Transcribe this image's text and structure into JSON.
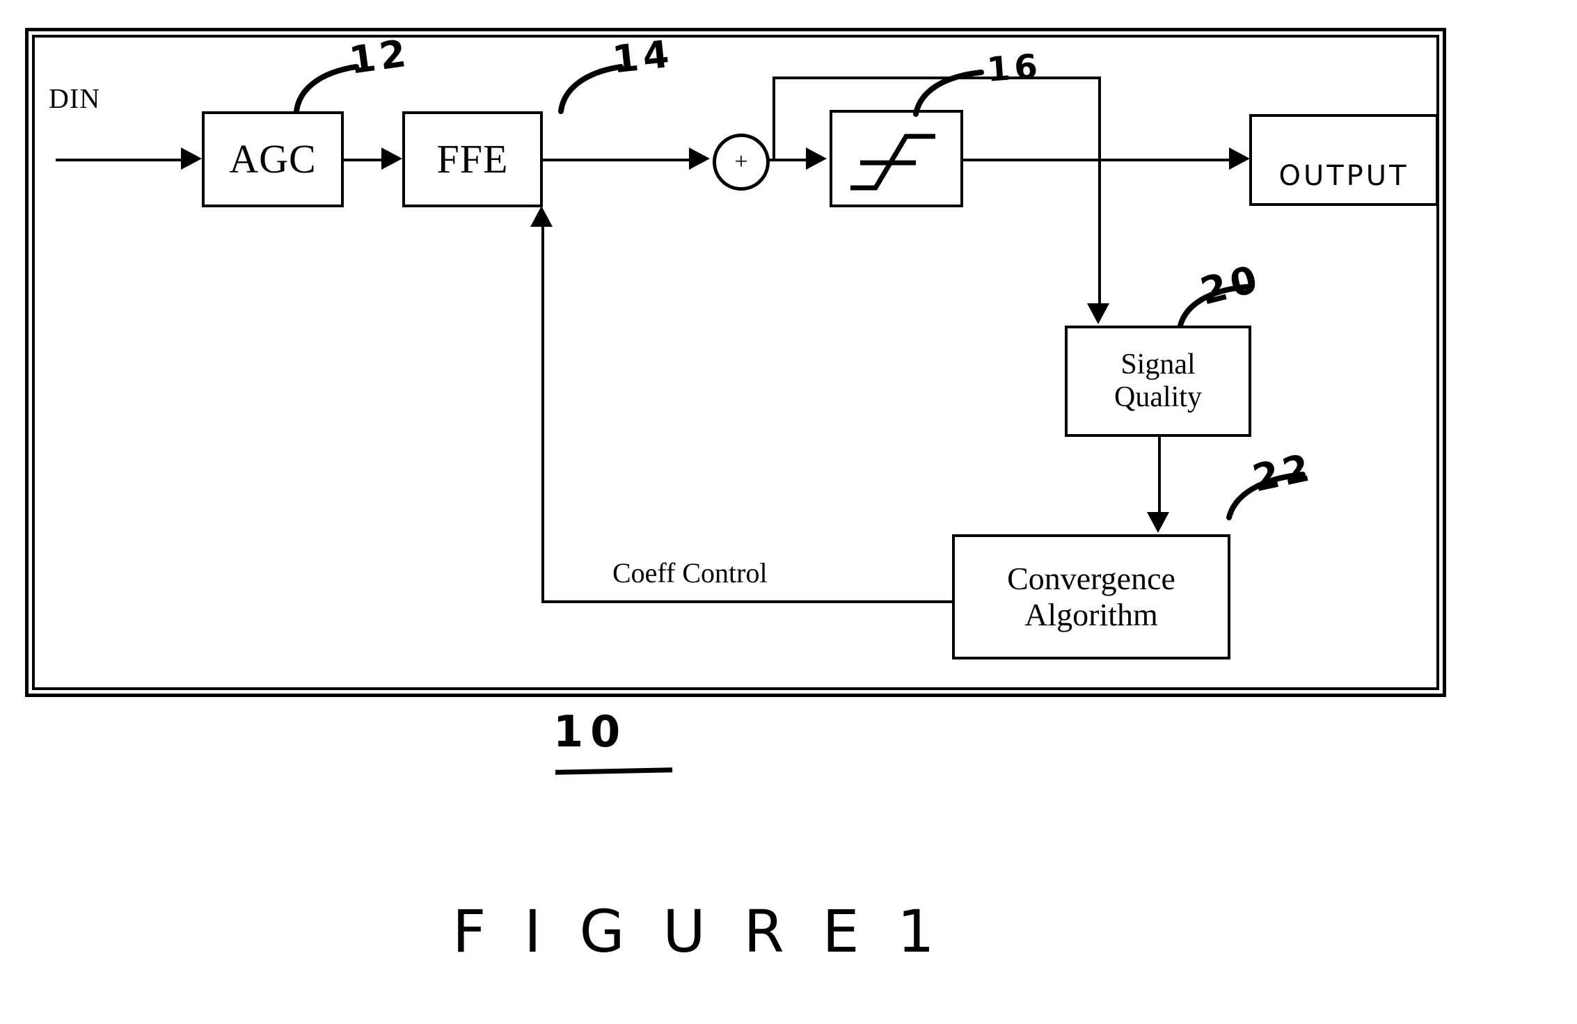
{
  "figure": {
    "caption": "F I G U R E  1",
    "system_ref": "10"
  },
  "frame": {
    "style": "double-rule-border"
  },
  "signals": {
    "din_label": "DIN",
    "coeff_control_label": "Coeff Control"
  },
  "blocks": [
    {
      "id": "agc",
      "label": "AGC",
      "ref": "12"
    },
    {
      "id": "ffe",
      "label": "FFE",
      "ref": "14"
    },
    {
      "id": "summer",
      "label": "+",
      "ref": ""
    },
    {
      "id": "slicer",
      "label": "",
      "ref": "16"
    },
    {
      "id": "output",
      "label": "OUTPUT",
      "ref": ""
    },
    {
      "id": "sq",
      "label": "Signal\nQuality",
      "ref": "20"
    },
    {
      "id": "conv",
      "label": "Convergence\nAlgorithm",
      "ref": "22"
    }
  ],
  "refs": {
    "agc": "12",
    "ffe": "14",
    "slicer": "16",
    "signal_quality": "20",
    "convergence_algorithm": "22"
  },
  "icons": {
    "slicer": "sigmoid-s-curve-icon",
    "summer": "plus-icon",
    "arrow_right": "arrow-right-icon",
    "arrow_down": "arrow-down-icon",
    "arrow_up": "arrow-up-icon",
    "leader_line": "leader-line-icon"
  },
  "colors": {
    "ink": "#000000",
    "paper": "#ffffff"
  }
}
